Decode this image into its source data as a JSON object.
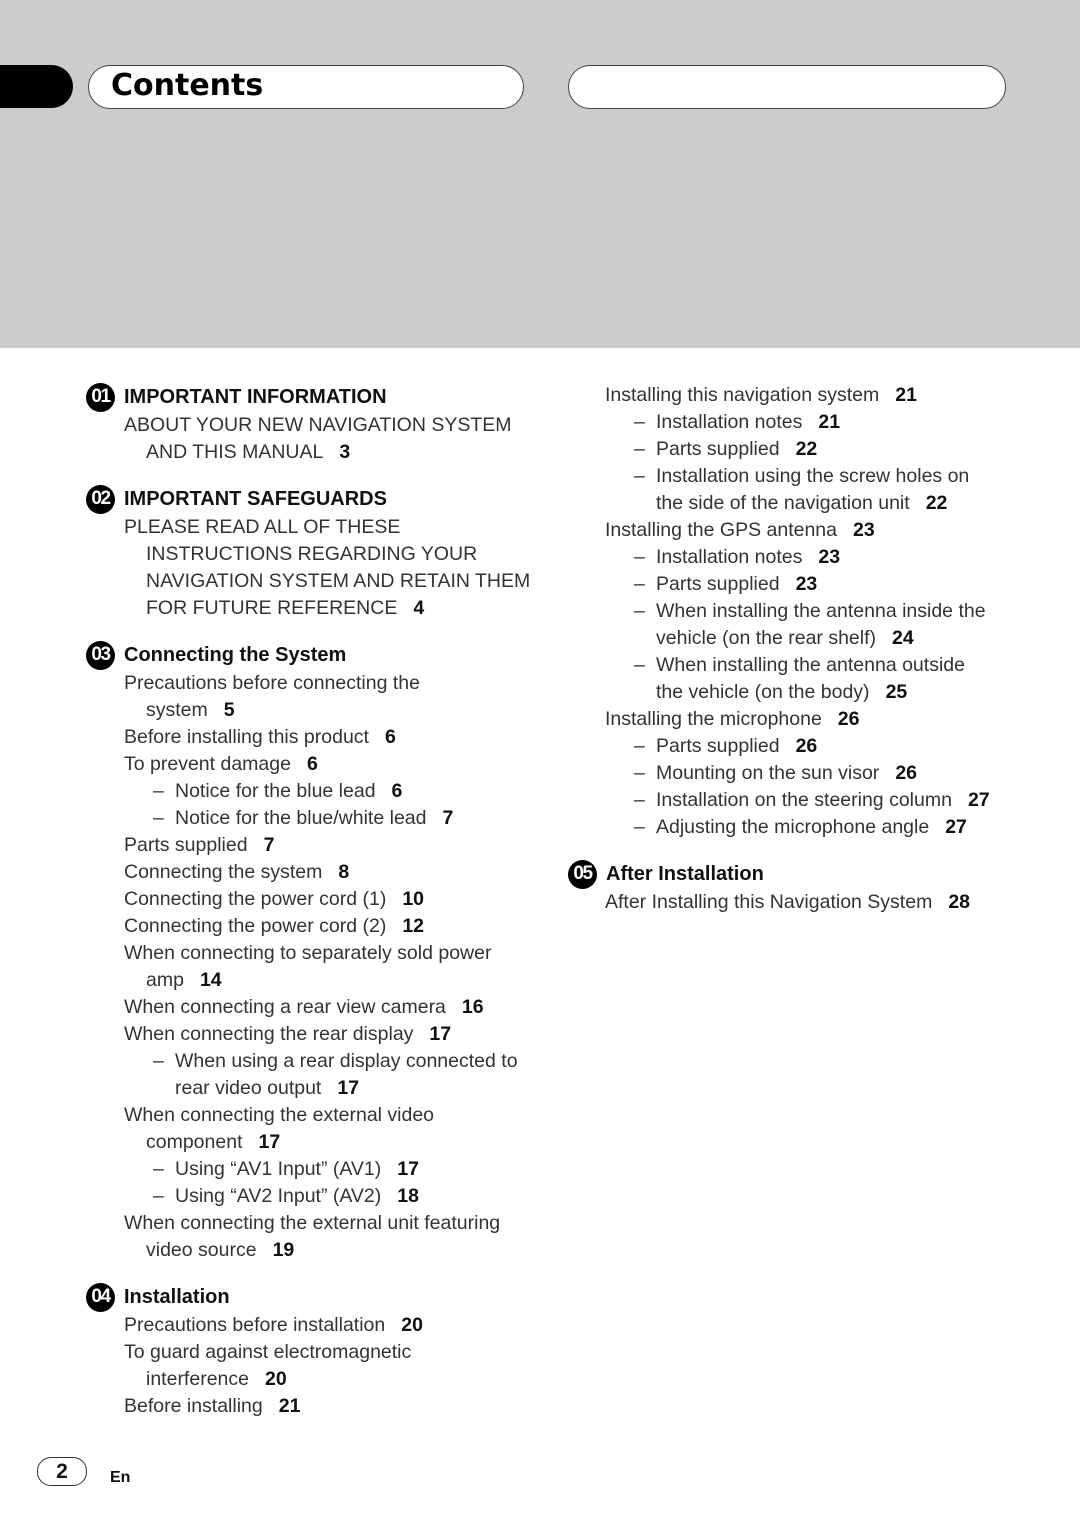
{
  "header": {
    "title": "Contents"
  },
  "colors": {
    "band": "#cccccc",
    "badge": "#000000"
  },
  "left_column": [
    {
      "number": "01",
      "title": "IMPORTANT INFORMATION",
      "entries": [
        {
          "level": 0,
          "lines": [
            "ABOUT YOUR NEW NAVIGATION SYSTEM",
            "AND THIS MANUAL"
          ],
          "page": "3"
        }
      ]
    },
    {
      "number": "02",
      "title": "IMPORTANT SAFEGUARDS",
      "entries": [
        {
          "level": 0,
          "lines": [
            "PLEASE READ ALL OF THESE",
            "INSTRUCTIONS REGARDING YOUR",
            "NAVIGATION SYSTEM AND RETAIN THEM",
            "FOR FUTURE REFERENCE"
          ],
          "page": "4"
        }
      ]
    },
    {
      "number": "03",
      "title": "Connecting the System",
      "entries": [
        {
          "level": 0,
          "lines": [
            "Precautions before connecting the",
            "system"
          ],
          "page": "5"
        },
        {
          "level": 0,
          "lines": [
            "Before installing this product"
          ],
          "page": "6"
        },
        {
          "level": 0,
          "lines": [
            "To prevent damage"
          ],
          "page": "6"
        },
        {
          "level": 1,
          "lines": [
            "Notice for the blue lead"
          ],
          "page": "6"
        },
        {
          "level": 1,
          "lines": [
            "Notice for the blue/white lead"
          ],
          "page": "7"
        },
        {
          "level": 0,
          "lines": [
            "Parts supplied"
          ],
          "page": "7"
        },
        {
          "level": 0,
          "lines": [
            "Connecting the system"
          ],
          "page": "8"
        },
        {
          "level": 0,
          "lines": [
            "Connecting the power cord (1)"
          ],
          "page": "10"
        },
        {
          "level": 0,
          "lines": [
            "Connecting the power cord (2)"
          ],
          "page": "12"
        },
        {
          "level": 0,
          "lines": [
            "When connecting to separately sold power",
            "amp"
          ],
          "page": "14"
        },
        {
          "level": 0,
          "lines": [
            "When connecting a rear view camera"
          ],
          "page": "16"
        },
        {
          "level": 0,
          "lines": [
            "When connecting the rear display"
          ],
          "page": "17"
        },
        {
          "level": 1,
          "lines": [
            "When using a rear display connected to",
            "rear video output"
          ],
          "page": "17"
        },
        {
          "level": 0,
          "lines": [
            "When connecting the external video",
            "component"
          ],
          "page": "17"
        },
        {
          "level": 1,
          "lines": [
            "Using “AV1 Input” (AV1)"
          ],
          "page": "17"
        },
        {
          "level": 1,
          "lines": [
            "Using “AV2 Input” (AV2)"
          ],
          "page": "18"
        },
        {
          "level": 0,
          "lines": [
            "When connecting the external unit featuring",
            "video source"
          ],
          "page": "19"
        }
      ]
    },
    {
      "number": "04",
      "title": "Installation",
      "entries": [
        {
          "level": 0,
          "lines": [
            "Precautions before installation"
          ],
          "page": "20"
        },
        {
          "level": 0,
          "lines": [
            "To guard against electromagnetic",
            "interference"
          ],
          "page": "20"
        },
        {
          "level": 0,
          "lines": [
            "Before installing"
          ],
          "page": "21"
        }
      ]
    }
  ],
  "right_column": [
    {
      "number": null,
      "title": null,
      "entries": [
        {
          "level": 0,
          "lines": [
            "Installing this navigation system"
          ],
          "page": "21"
        },
        {
          "level": 1,
          "lines": [
            "Installation notes"
          ],
          "page": "21"
        },
        {
          "level": 1,
          "lines": [
            "Parts supplied"
          ],
          "page": "22"
        },
        {
          "level": 1,
          "lines": [
            "Installation using the screw holes on",
            "the side of the navigation unit"
          ],
          "page": "22"
        },
        {
          "level": 0,
          "lines": [
            "Installing the GPS antenna"
          ],
          "page": "23"
        },
        {
          "level": 1,
          "lines": [
            "Installation notes"
          ],
          "page": "23"
        },
        {
          "level": 1,
          "lines": [
            "Parts supplied"
          ],
          "page": "23"
        },
        {
          "level": 1,
          "lines": [
            "When installing the antenna inside the",
            "vehicle (on the rear shelf)"
          ],
          "page": "24"
        },
        {
          "level": 1,
          "lines": [
            "When installing the antenna outside",
            "the vehicle (on the body)"
          ],
          "page": "25"
        },
        {
          "level": 0,
          "lines": [
            "Installing the microphone"
          ],
          "page": "26"
        },
        {
          "level": 1,
          "lines": [
            "Parts supplied"
          ],
          "page": "26"
        },
        {
          "level": 1,
          "lines": [
            "Mounting on the sun visor"
          ],
          "page": "26"
        },
        {
          "level": 1,
          "lines": [
            "Installation on the steering column"
          ],
          "page": "27"
        },
        {
          "level": 1,
          "lines": [
            "Adjusting the microphone angle"
          ],
          "page": "27"
        }
      ]
    },
    {
      "number": "05",
      "title": "After Installation",
      "entries": [
        {
          "level": 0,
          "lines": [
            "After Installing this Navigation System"
          ],
          "page": "28"
        }
      ]
    }
  ],
  "footer": {
    "page_number": "2",
    "language": "En",
    "dash": "–"
  }
}
